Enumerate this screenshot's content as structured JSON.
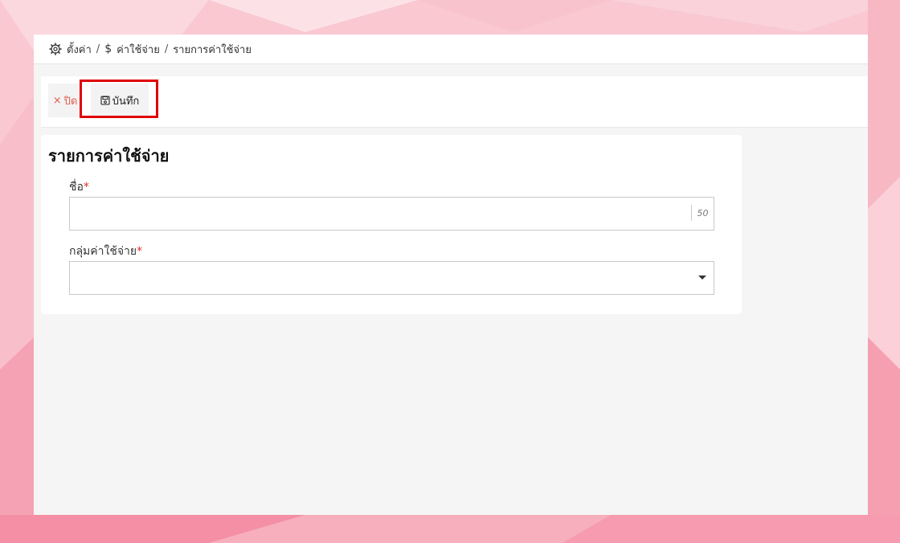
{
  "breadcrumb": {
    "settings_icon": "gear-icon",
    "settings": "ตั้งค่า",
    "separator": "/",
    "expenses_icon": "dollar-icon",
    "expenses_symbol": "$",
    "expenses": "ค่าใช้จ่าย",
    "current": "รายการค่าใช้จ่าย"
  },
  "toolbar": {
    "close_icon": "close-icon",
    "close_symbol": "×",
    "close_label": "ปิด",
    "save_icon": "floppy-disk-icon",
    "save_label": "บันทึก"
  },
  "form": {
    "title": "รายการค่าใช้จ่าย",
    "required_mark": "*",
    "name_label": "ชื่อ",
    "name_value": "",
    "name_max_length": "50",
    "group_label": "กลุ่มค่าใช้จ่าย",
    "group_value": ""
  },
  "colors": {
    "highlight": "#e00000",
    "required": "#d9302c",
    "close": "#e0604f"
  }
}
